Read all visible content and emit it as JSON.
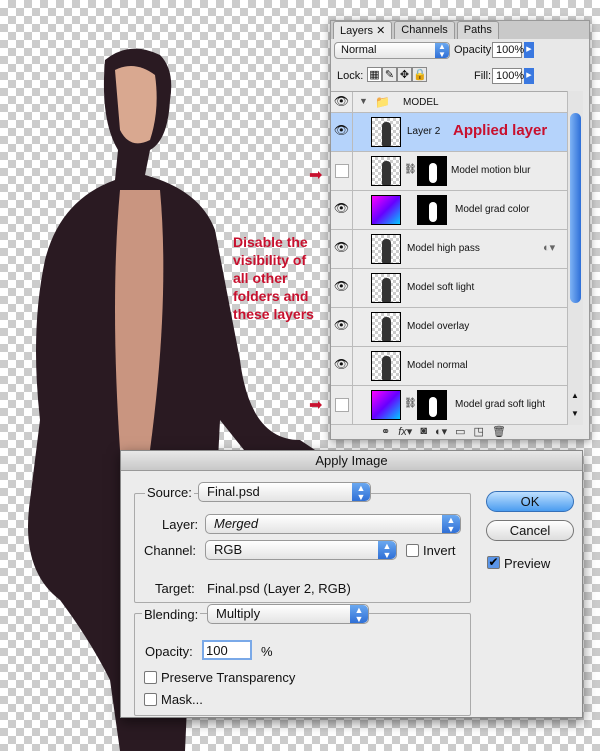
{
  "annotations": {
    "applied_layer": "Applied layer",
    "disable_note": "Disable the visibility of all other folders and these layers"
  },
  "layers_panel": {
    "tabs": [
      {
        "label": "Layers ✕"
      },
      {
        "label": "Channels"
      },
      {
        "label": "Paths"
      }
    ],
    "blend_mode": "Normal",
    "opacity_label": "Opacity:",
    "opacity": "100%",
    "lock_label": "Lock:",
    "fill_label": "Fill:",
    "fill": "100%",
    "group": "MODEL",
    "layers": [
      {
        "name": "Layer 2"
      },
      {
        "name": "Model motion blur"
      },
      {
        "name": "Model grad color"
      },
      {
        "name": "Model high pass"
      },
      {
        "name": "Model soft light"
      },
      {
        "name": "Model overlay"
      },
      {
        "name": "Model normal"
      },
      {
        "name": "Model grad soft light"
      }
    ],
    "footer_icons": [
      "link-icon",
      "fx-icon",
      "mask-icon",
      "adjustment-icon",
      "folder-icon",
      "new-layer-icon",
      "trash-icon"
    ]
  },
  "dialog": {
    "title": "Apply Image",
    "source_label": "Source:",
    "source": "Final.psd",
    "layer_label": "Layer:",
    "layer": "Merged",
    "channel_label": "Channel:",
    "channel": "RGB",
    "invert_label": "Invert",
    "target_label": "Target:",
    "target": "Final.psd (Layer 2, RGB)",
    "blending_label": "Blending:",
    "blending": "Multiply",
    "opacity_label": "Opacity:",
    "opacity": "100",
    "percent": "%",
    "preserve_label": "Preserve Transparency",
    "mask_label": "Mask...",
    "ok": "OK",
    "cancel": "Cancel",
    "preview_label": "Preview"
  },
  "colors": {
    "annotation": "#c8102e",
    "selected_row": "#b5d3fb"
  }
}
